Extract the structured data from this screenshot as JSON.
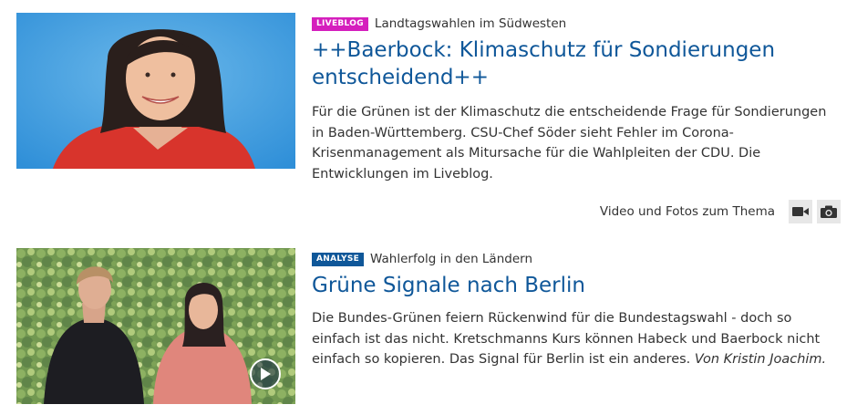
{
  "teasers": [
    {
      "badge": "LIVEBLOG",
      "kicker": "Landtagswahlen im Südwesten",
      "headline": "++Baerbock: Klimaschutz für Sondierungen entscheidend++",
      "description": "Für die Grünen ist der Klimaschutz die entscheidende Frage für Sondierungen in Baden-Württemberg. CSU-Chef Söder sieht Fehler im Corona-Krisenmanagement als Mitursache für die Wahlpleiten der CDU. Die Entwicklungen im Liveblog.",
      "media_label": "Video und Fotos zum Thema",
      "media_icons": [
        "video-camera-icon",
        "photo-camera-icon"
      ]
    },
    {
      "badge": "ANALYSE",
      "kicker": "Wahlerfolg in den Ländern",
      "headline": "Grüne Signale nach Berlin",
      "description": "Die Bundes-Grünen feiern Rückenwind für die Bundestagswahl - doch so einfach ist das nicht. Kretschmanns Kurs können Habeck und Baerbock nicht einfach so kopieren. Das Signal für Berlin ist ein anderes.",
      "author": "Von Kristin Joachim.",
      "video_icon": "play-icon"
    }
  ],
  "colors": {
    "link": "#0f5799",
    "liveblog_badge": "#d51fbd",
    "analyse_badge": "#0f5799"
  }
}
